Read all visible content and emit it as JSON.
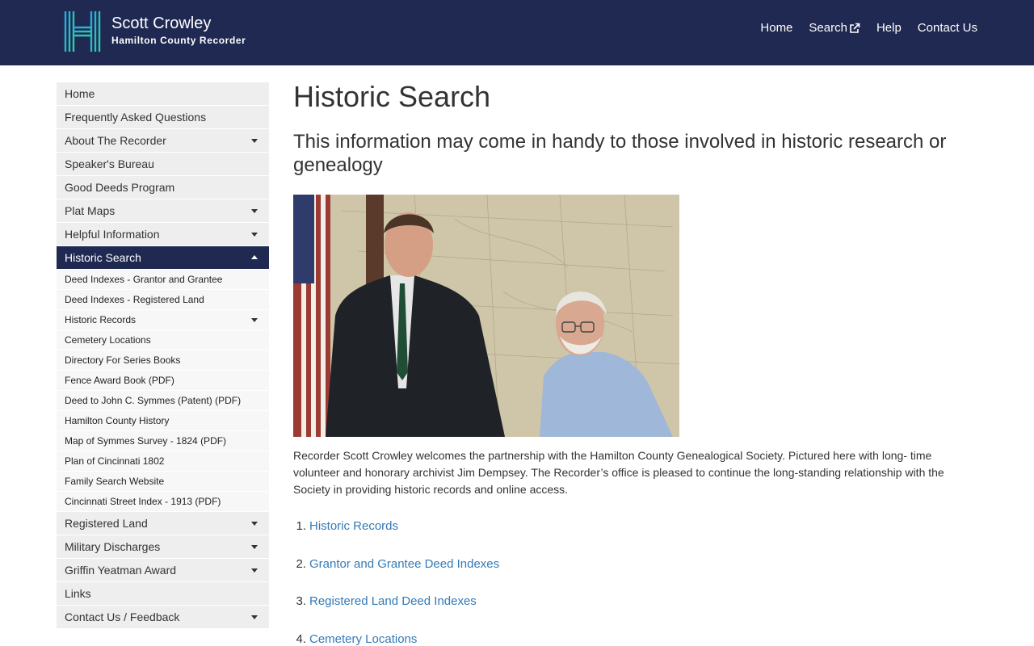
{
  "header": {
    "brand_name": "Scott Crowley",
    "brand_sub": "Hamilton County Recorder",
    "logo_letter": "H",
    "nav": [
      {
        "label": "Home"
      },
      {
        "label": "Search",
        "icon": "external-link-icon"
      },
      {
        "label": "Help"
      },
      {
        "label": "Contact Us"
      }
    ]
  },
  "sidebar": {
    "items": [
      {
        "label": "Home"
      },
      {
        "label": "Frequently Asked Questions"
      },
      {
        "label": "About The Recorder",
        "caret": "down"
      },
      {
        "label": "Speaker's Bureau"
      },
      {
        "label": "Good Deeds Program"
      },
      {
        "label": "Plat Maps",
        "caret": "down"
      },
      {
        "label": "Helpful Information",
        "caret": "down"
      },
      {
        "label": "Historic Search",
        "caret": "up",
        "active": true
      }
    ],
    "subitems": [
      {
        "label": "Deed Indexes - Grantor and Grantee"
      },
      {
        "label": "Deed Indexes - Registered Land"
      },
      {
        "label": "Historic Records",
        "caret": "down"
      },
      {
        "label": "Cemetery Locations"
      },
      {
        "label": "Directory For Series Books"
      },
      {
        "label": "Fence Award Book (PDF)"
      },
      {
        "label": "Deed to John C. Symmes (Patent) (PDF)"
      },
      {
        "label": "Hamilton County History"
      },
      {
        "label": "Map of Symmes Survey - 1824 (PDF)"
      },
      {
        "label": "Plan of Cincinnati 1802"
      },
      {
        "label": "Family Search Website"
      },
      {
        "label": "Cincinnati Street Index - 1913 (PDF)"
      }
    ],
    "items_after": [
      {
        "label": "Registered Land",
        "caret": "down"
      },
      {
        "label": "Military Discharges",
        "caret": "down"
      },
      {
        "label": "Griffin Yeatman Award",
        "caret": "down"
      },
      {
        "label": "Links"
      },
      {
        "label": "Contact Us / Feedback",
        "caret": "down"
      }
    ]
  },
  "main": {
    "title": "Historic Search",
    "subtitle": "This information may come in handy to those involved in historic research or genealogy",
    "description": "Recorder Scott Crowley welcomes the partnership with the Hamilton County Genealogical Society. Pictured here with long- time volunteer and honorary archivist Jim Dempsey. The Recorder’s office is pleased to continue the long-standing relationship with the Society in providing historic records and online access.",
    "links": [
      {
        "num": "1.",
        "label": "Historic Records"
      },
      {
        "num": "2.",
        "label": "Grantor and Grantee Deed Indexes"
      },
      {
        "num": "3.",
        "label": "Registered Land Deed Indexes"
      },
      {
        "num": "4.",
        "label": "Cemetery Locations"
      }
    ]
  },
  "colors": {
    "header_bg": "#1f2952",
    "active_bg": "#1f2952",
    "sidebar_bg": "#eeeeee",
    "sub_bg": "#f7f7f7",
    "link": "#337ab7",
    "logo_gradient": [
      "#27a9e1",
      "#2ed1a2"
    ]
  }
}
